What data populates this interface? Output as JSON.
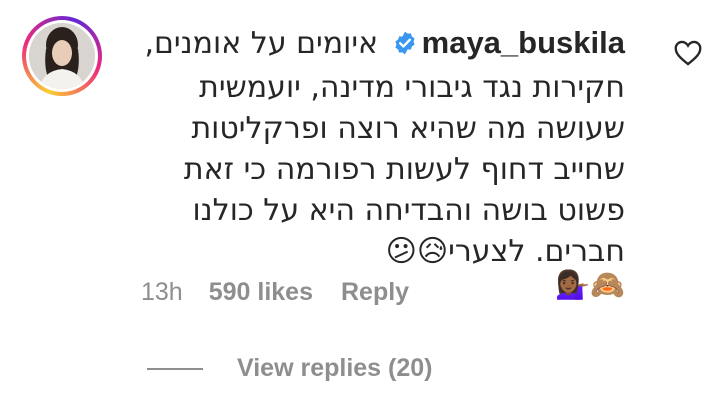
{
  "comment": {
    "username": "maya_buskila",
    "verified": true,
    "text": "איומים על אומנים, חקירות נגד גיבורי מדינה, יועמשית שעושה מה שהיא רוצה ופרקליטות שחייב דחוף לעשות רפורמה כי זאת פשוט בושה והבדיחה היא על כולנו חברים. לצערי😥😕",
    "emoji_line": "🙈💁🏾‍♀️",
    "time": "13h",
    "likes": "590 likes",
    "reply_label": "Reply",
    "view_replies": "View replies (20)"
  },
  "icons": {
    "like": "heart-outline-icon",
    "verified": "verified-badge-icon"
  },
  "colors": {
    "verified_blue": "#3897f0",
    "meta_gray": "#8e8e8e",
    "text": "#262626"
  }
}
